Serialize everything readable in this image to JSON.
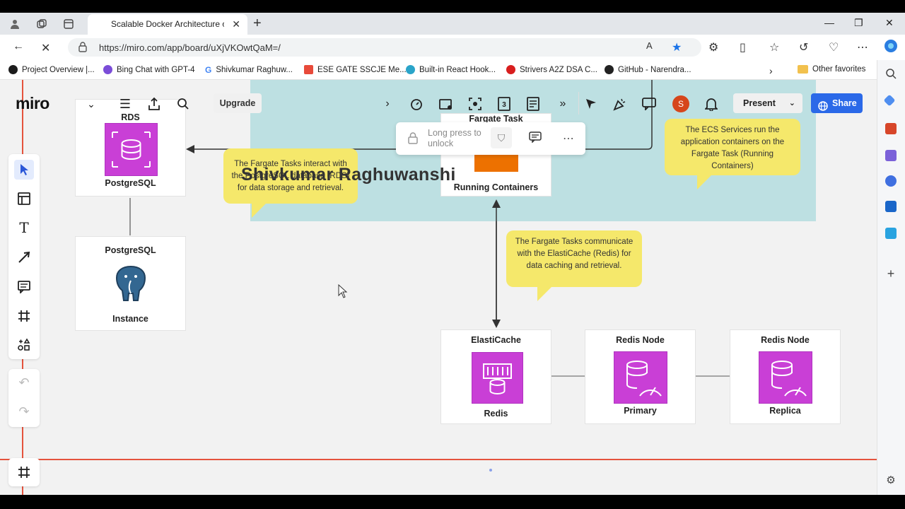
{
  "browser": {
    "tab_title": "Scalable Docker Architecture on",
    "url": "https://miro.com/app/board/uXjVKOwtQaM=/",
    "favorites": [
      {
        "label": "Project Overview |...",
        "color": "#1c1c1c"
      },
      {
        "label": "Bing Chat with GPT-4",
        "color": "#7b4dd8"
      },
      {
        "label": "Shivkumar Raghuw...",
        "color": "#4285f4"
      },
      {
        "label": "ESE GATE SSCJE Me...",
        "color": "#e84a3a"
      },
      {
        "label": "Built-in React Hook...",
        "color": "#2aa4c9"
      },
      {
        "label": "Strivers A2Z DSA C...",
        "color": "#d81e1e"
      },
      {
        "label": "GitHub - Narendra...",
        "color": "#222222"
      }
    ],
    "other_favorites": "Other favorites"
  },
  "toolbar": {
    "logo": "miro",
    "upgrade": "Upgrade",
    "present": "Present",
    "share": "Share",
    "avatar_initial": "S"
  },
  "lock_popup": {
    "text": "Long press to unlock"
  },
  "board": {
    "author": "Shivkumar Raghuwanshi",
    "rds_card": {
      "title": "RDS",
      "caption": "PostgreSQL"
    },
    "pg_card": {
      "title": "PostgreSQL",
      "caption": "Instance"
    },
    "fargate_card": {
      "title": "Fargate Task",
      "caption": "Running Containers"
    },
    "elasticache_card": {
      "title": "ElastiCache",
      "caption": "Redis"
    },
    "redis_primary": {
      "title": "Redis Node",
      "caption": "Primary"
    },
    "redis_replica": {
      "title": "Redis Node",
      "caption": "Replica"
    },
    "sticky_rds": "The Fargate Tasks interact with the PostgreSQL database (RDS) for data storage and retrieval.",
    "sticky_ecs": "The ECS Services run the application containers on the Fargate Task (Running Containers)",
    "sticky_cache": "The Fargate Tasks communicate with the ElastiCache (Redis) for data caching and retrieval."
  },
  "colors": {
    "aws_db": "#c93fd6",
    "fargate": "#ed7100",
    "sticky": "#f5e86b",
    "share": "#2b69e8",
    "teal_frame": "#bde0e2"
  }
}
